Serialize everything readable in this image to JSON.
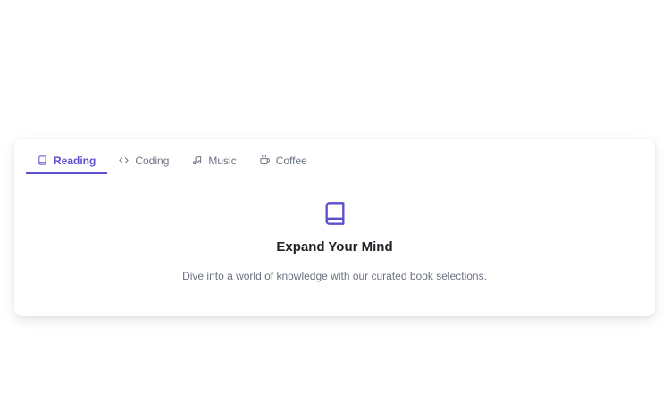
{
  "tabs": [
    {
      "label": "Reading",
      "icon": "book-icon",
      "active": true
    },
    {
      "label": "Coding",
      "icon": "code-icon",
      "active": false
    },
    {
      "label": "Music",
      "icon": "music-note-icon",
      "active": false
    },
    {
      "label": "Coffee",
      "icon": "coffee-cup-icon",
      "active": false
    }
  ],
  "panel": {
    "icon": "book-icon",
    "title": "Expand Your Mind",
    "description": "Dive into a world of knowledge with our curated book selections."
  },
  "colors": {
    "accent": "#5b4fcf",
    "text_muted": "#6b7280",
    "title": "#1f2328"
  }
}
